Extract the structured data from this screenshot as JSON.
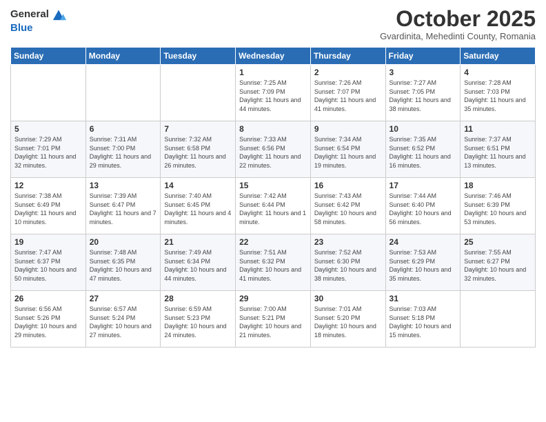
{
  "header": {
    "logo_general": "General",
    "logo_blue": "Blue",
    "month_title": "October 2025",
    "location": "Gvardinita, Mehedinti County, Romania"
  },
  "days_of_week": [
    "Sunday",
    "Monday",
    "Tuesday",
    "Wednesday",
    "Thursday",
    "Friday",
    "Saturday"
  ],
  "weeks": [
    [
      {
        "day": "",
        "info": ""
      },
      {
        "day": "",
        "info": ""
      },
      {
        "day": "",
        "info": ""
      },
      {
        "day": "1",
        "info": "Sunrise: 7:25 AM\nSunset: 7:09 PM\nDaylight: 11 hours and 44 minutes."
      },
      {
        "day": "2",
        "info": "Sunrise: 7:26 AM\nSunset: 7:07 PM\nDaylight: 11 hours and 41 minutes."
      },
      {
        "day": "3",
        "info": "Sunrise: 7:27 AM\nSunset: 7:05 PM\nDaylight: 11 hours and 38 minutes."
      },
      {
        "day": "4",
        "info": "Sunrise: 7:28 AM\nSunset: 7:03 PM\nDaylight: 11 hours and 35 minutes."
      }
    ],
    [
      {
        "day": "5",
        "info": "Sunrise: 7:29 AM\nSunset: 7:01 PM\nDaylight: 11 hours and 32 minutes."
      },
      {
        "day": "6",
        "info": "Sunrise: 7:31 AM\nSunset: 7:00 PM\nDaylight: 11 hours and 29 minutes."
      },
      {
        "day": "7",
        "info": "Sunrise: 7:32 AM\nSunset: 6:58 PM\nDaylight: 11 hours and 26 minutes."
      },
      {
        "day": "8",
        "info": "Sunrise: 7:33 AM\nSunset: 6:56 PM\nDaylight: 11 hours and 22 minutes."
      },
      {
        "day": "9",
        "info": "Sunrise: 7:34 AM\nSunset: 6:54 PM\nDaylight: 11 hours and 19 minutes."
      },
      {
        "day": "10",
        "info": "Sunrise: 7:35 AM\nSunset: 6:52 PM\nDaylight: 11 hours and 16 minutes."
      },
      {
        "day": "11",
        "info": "Sunrise: 7:37 AM\nSunset: 6:51 PM\nDaylight: 11 hours and 13 minutes."
      }
    ],
    [
      {
        "day": "12",
        "info": "Sunrise: 7:38 AM\nSunset: 6:49 PM\nDaylight: 11 hours and 10 minutes."
      },
      {
        "day": "13",
        "info": "Sunrise: 7:39 AM\nSunset: 6:47 PM\nDaylight: 11 hours and 7 minutes."
      },
      {
        "day": "14",
        "info": "Sunrise: 7:40 AM\nSunset: 6:45 PM\nDaylight: 11 hours and 4 minutes."
      },
      {
        "day": "15",
        "info": "Sunrise: 7:42 AM\nSunset: 6:44 PM\nDaylight: 11 hours and 1 minute."
      },
      {
        "day": "16",
        "info": "Sunrise: 7:43 AM\nSunset: 6:42 PM\nDaylight: 10 hours and 58 minutes."
      },
      {
        "day": "17",
        "info": "Sunrise: 7:44 AM\nSunset: 6:40 PM\nDaylight: 10 hours and 56 minutes."
      },
      {
        "day": "18",
        "info": "Sunrise: 7:46 AM\nSunset: 6:39 PM\nDaylight: 10 hours and 53 minutes."
      }
    ],
    [
      {
        "day": "19",
        "info": "Sunrise: 7:47 AM\nSunset: 6:37 PM\nDaylight: 10 hours and 50 minutes."
      },
      {
        "day": "20",
        "info": "Sunrise: 7:48 AM\nSunset: 6:35 PM\nDaylight: 10 hours and 47 minutes."
      },
      {
        "day": "21",
        "info": "Sunrise: 7:49 AM\nSunset: 6:34 PM\nDaylight: 10 hours and 44 minutes."
      },
      {
        "day": "22",
        "info": "Sunrise: 7:51 AM\nSunset: 6:32 PM\nDaylight: 10 hours and 41 minutes."
      },
      {
        "day": "23",
        "info": "Sunrise: 7:52 AM\nSunset: 6:30 PM\nDaylight: 10 hours and 38 minutes."
      },
      {
        "day": "24",
        "info": "Sunrise: 7:53 AM\nSunset: 6:29 PM\nDaylight: 10 hours and 35 minutes."
      },
      {
        "day": "25",
        "info": "Sunrise: 7:55 AM\nSunset: 6:27 PM\nDaylight: 10 hours and 32 minutes."
      }
    ],
    [
      {
        "day": "26",
        "info": "Sunrise: 6:56 AM\nSunset: 5:26 PM\nDaylight: 10 hours and 29 minutes."
      },
      {
        "day": "27",
        "info": "Sunrise: 6:57 AM\nSunset: 5:24 PM\nDaylight: 10 hours and 27 minutes."
      },
      {
        "day": "28",
        "info": "Sunrise: 6:59 AM\nSunset: 5:23 PM\nDaylight: 10 hours and 24 minutes."
      },
      {
        "day": "29",
        "info": "Sunrise: 7:00 AM\nSunset: 5:21 PM\nDaylight: 10 hours and 21 minutes."
      },
      {
        "day": "30",
        "info": "Sunrise: 7:01 AM\nSunset: 5:20 PM\nDaylight: 10 hours and 18 minutes."
      },
      {
        "day": "31",
        "info": "Sunrise: 7:03 AM\nSunset: 5:18 PM\nDaylight: 10 hours and 15 minutes."
      },
      {
        "day": "",
        "info": ""
      }
    ]
  ]
}
